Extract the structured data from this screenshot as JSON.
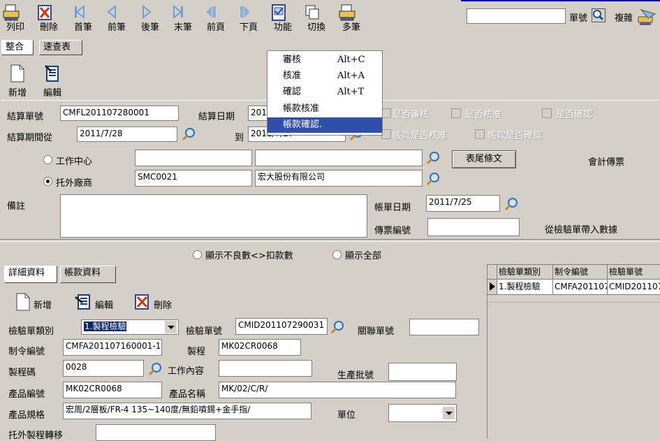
{
  "toolbar": {
    "print": "列印",
    "delete": "刪除",
    "first": "首筆",
    "prev": "前筆",
    "next": "後筆",
    "last": "末筆",
    "prev_page": "前頁",
    "next_page": "下頁",
    "function": "功能",
    "switch": "切換",
    "multi": "多筆",
    "doc_no_label": "單號",
    "copy_label": "複雜"
  },
  "top_tabs": {
    "combine": "整合",
    "quick": "速查表"
  },
  "sub_toolbar": {
    "new": "新增",
    "edit": "編輯"
  },
  "context_menu": [
    {
      "label": "審核",
      "shortcut": "Alt+C"
    },
    {
      "label": "核准",
      "shortcut": "Alt+A"
    },
    {
      "label": "確認",
      "shortcut": "Alt+T"
    },
    {
      "label": "帳款核准",
      "shortcut": ""
    },
    {
      "label": "帳款確認.",
      "shortcut": ""
    }
  ],
  "header": {
    "settle_no_label": "結算單號",
    "settle_no": "CMFL201107280001",
    "settle_date_label": "結算日期",
    "settle_date": "2011/7/28",
    "period_from_label": "結算期間從",
    "period_from": "2011/7/28",
    "period_to_label": "到",
    "period_to": "2011/7/27",
    "is_reviewed": "是否審核",
    "is_approved": "是否核准",
    "is_confirmed": "是否確認",
    "ar_approved": "帳款是否核准",
    "ar_confirmed": "帳款是否確認",
    "work_center_label": "工作中心",
    "vendor_label": "托外廠商",
    "vendor_code": "SMC0021",
    "vendor_name": "宏大股份有限公司",
    "footer_terms_button": "表尾條文",
    "accounting_voucher": "會計傳票",
    "remark_label": "備註",
    "bill_date_label": "帳單日期",
    "bill_date": "2011/7/25",
    "voucher_no_label": "傳票編號",
    "bring_in_label": "從檢驗單帶入數據"
  },
  "filters": {
    "show_defect": "顯示不良數<>扣款數",
    "show_all": "顯示全部"
  },
  "detail_tabs": {
    "detail": "詳細資料",
    "payment": "帳款資料"
  },
  "detail_toolbar": {
    "new": "新增",
    "edit": "編輯",
    "delete": "刪除"
  },
  "detail": {
    "insp_type_label": "檢驗單類別",
    "insp_type": "1.製程檢驗",
    "insp_no_label": "檢驗單號",
    "insp_no": "CMID201107290031",
    "related_no_label": "關聯單號",
    "order_no_label": "制令編號",
    "order_no": "CMFA201107160001-1",
    "process_label": "製程",
    "process": "MK02CR0068",
    "process_code_label": "製程碼",
    "process_code": "0028",
    "work_content_label": "工作內容",
    "batch_no_label": "生產批號",
    "product_no_label": "產品編號",
    "product_no": "MK02CR0068",
    "product_name_label": "產品名稱",
    "product_name": "MK/02/C/R/",
    "spec_label": "產品規格",
    "spec": "宏周/2層板/FR-4 135~140度/無鉛噴錫+金手指/",
    "unit_label": "單位",
    "outsource_transfer_label": "托外製程轉移"
  },
  "grid": {
    "headers": [
      "檢驗單類別",
      "制令編號",
      "檢驗單號"
    ],
    "rows": [
      [
        "1.製程檢驗",
        "CMFA2011071",
        "CMID201107"
      ]
    ]
  }
}
